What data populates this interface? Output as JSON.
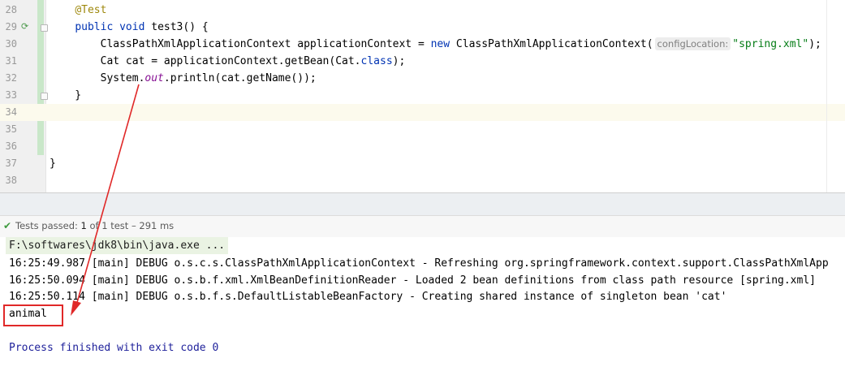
{
  "editor": {
    "lines": [
      {
        "num": "28",
        "tokens": [
          {
            "t": "    ",
            "c": ""
          },
          {
            "t": "@Test",
            "c": "ann"
          }
        ]
      },
      {
        "num": "29",
        "tokens": [
          {
            "t": "    ",
            "c": ""
          },
          {
            "t": "public",
            "c": "kw"
          },
          {
            "t": " ",
            "c": ""
          },
          {
            "t": "void",
            "c": "kw"
          },
          {
            "t": " test3() {",
            "c": ""
          }
        ]
      },
      {
        "num": "30",
        "tokens": [
          {
            "t": "        ClassPathXmlApplicationContext applicationContext = ",
            "c": ""
          },
          {
            "t": "new",
            "c": "kw"
          },
          {
            "t": " ClassPathXmlApplicationContext(",
            "c": ""
          },
          {
            "t": "configLocation:",
            "c": "hint"
          },
          {
            "t": "\"spring.xml\"",
            "c": "str"
          },
          {
            "t": ");",
            "c": ""
          }
        ]
      },
      {
        "num": "31",
        "tokens": [
          {
            "t": "        Cat cat = applicationContext.getBean(Cat.",
            "c": ""
          },
          {
            "t": "class",
            "c": "kw"
          },
          {
            "t": ");",
            "c": ""
          }
        ]
      },
      {
        "num": "32",
        "tokens": [
          {
            "t": "        System.",
            "c": ""
          },
          {
            "t": "out",
            "c": "fld"
          },
          {
            "t": ".println(cat.getName());",
            "c": ""
          }
        ]
      },
      {
        "num": "33",
        "tokens": [
          {
            "t": "    }",
            "c": ""
          }
        ]
      },
      {
        "num": "34",
        "tokens": []
      },
      {
        "num": "35",
        "tokens": []
      },
      {
        "num": "36",
        "tokens": []
      },
      {
        "num": "37",
        "tokens": [
          {
            "t": "}",
            "c": ""
          }
        ]
      },
      {
        "num": "38",
        "tokens": []
      }
    ],
    "current_line": "34",
    "run_icon": "run-test-icon"
  },
  "test_bar": {
    "check_icon": "test-passed-icon",
    "label": "Tests passed:",
    "passed": "1",
    "rest": " of 1 test – 291 ms"
  },
  "console": {
    "command": "F:\\softwares\\jdk8\\bin\\java.exe ...",
    "logs": [
      "16:25:49.987 [main] DEBUG o.s.c.s.ClassPathXmlApplicationContext - Refreshing org.springframework.context.support.ClassPathXmlApp",
      "16:25:50.094 [main] DEBUG o.s.b.f.xml.XmlBeanDefinitionReader - Loaded 2 bean definitions from class path resource [spring.xml]",
      "16:25:50.114 [main] DEBUG o.s.b.f.s.DefaultListableBeanFactory - Creating shared instance of singleton bean 'cat'"
    ],
    "output": "animal",
    "exit": "Process finished with exit code 0"
  },
  "colors": {
    "annotation_arrow": "#e02828",
    "keyword": "#0033b3",
    "string": "#067d17"
  }
}
